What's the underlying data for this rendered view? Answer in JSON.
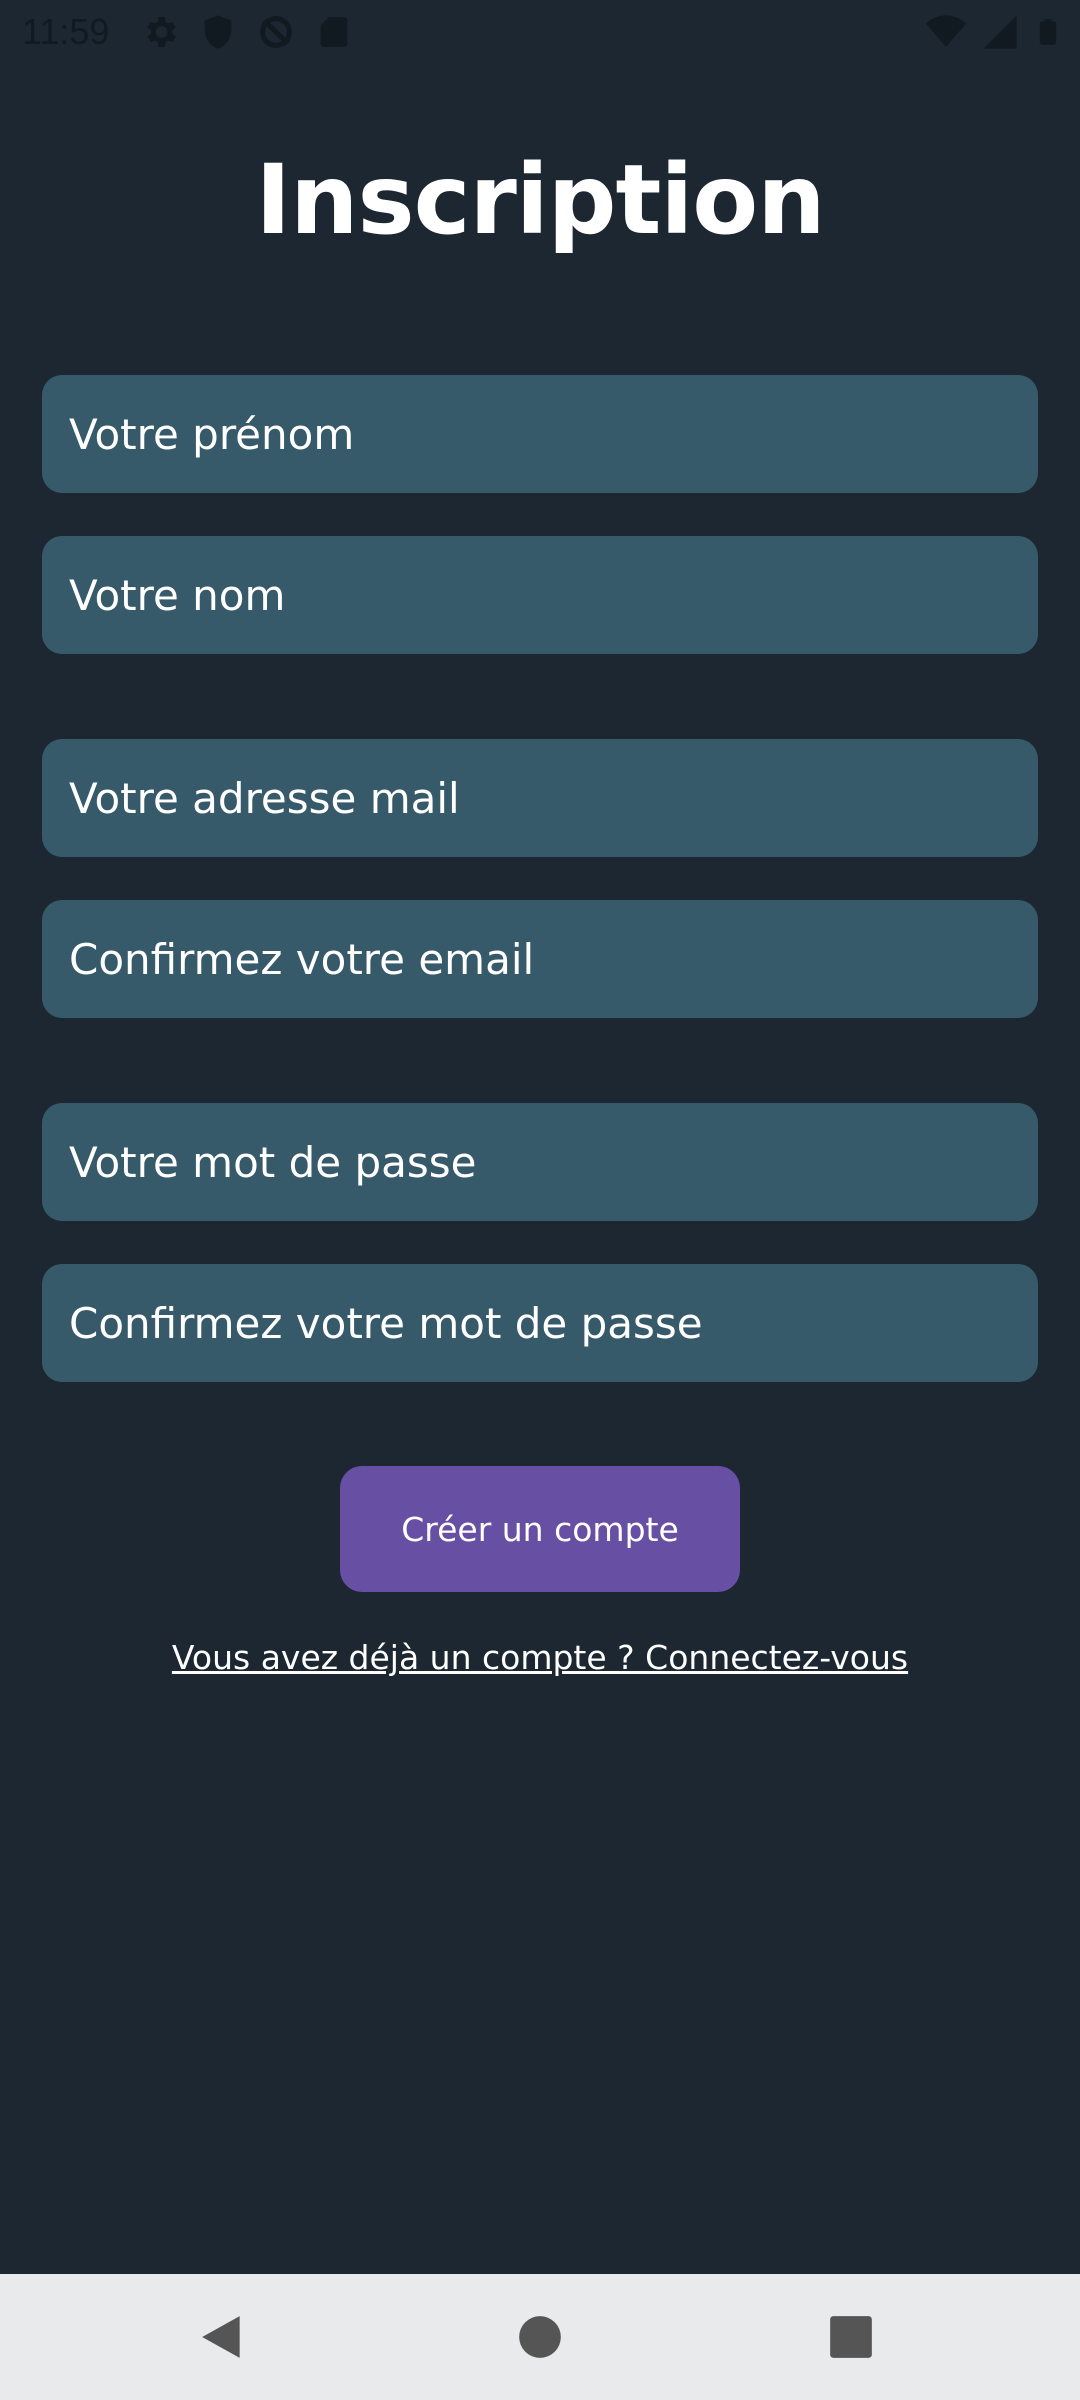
{
  "status_bar": {
    "time": "11:59",
    "left_icons": [
      "gear-icon",
      "shield-icon",
      "sync-off-icon",
      "sd-card-icon"
    ],
    "right_icons": [
      "wifi-icon",
      "cellular-signal-icon",
      "battery-icon"
    ]
  },
  "signup": {
    "title": "Inscription",
    "fields": {
      "first_name_placeholder": "Votre prénom",
      "last_name_placeholder": "Votre nom",
      "email_placeholder": "Votre adresse mail",
      "confirm_email_placeholder": "Confirmez votre email",
      "password_placeholder": "Votre mot de passe",
      "confirm_password_placeholder": "Confirmez votre mot de passe"
    },
    "submit_label": "Créer un compte",
    "login_link": "Vous avez déjà un compte ? Connectez-vous"
  },
  "navigation": {
    "icons": [
      "back-icon",
      "home-icon",
      "recents-icon"
    ]
  },
  "colors": {
    "background": "#1c2731",
    "field": "#375a6b",
    "button": "#674fa3",
    "nav_bar": "#e9eaec"
  }
}
